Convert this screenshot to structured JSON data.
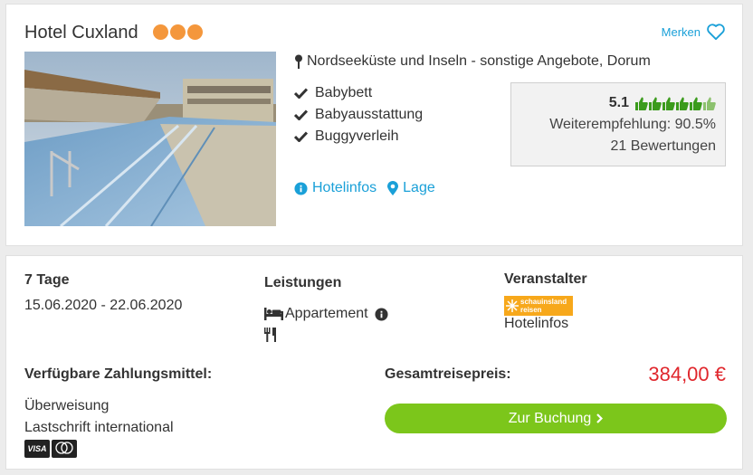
{
  "hotel": {
    "name": "Hotel Cuxland",
    "category_dots": 3,
    "merken_label": "Merken",
    "location": "Nordseeküste und Inseln - sonstige Angebote, Dorum",
    "features": [
      "Babybett",
      "Babyausstattung",
      "Buggyverleih"
    ],
    "links": {
      "hotelinfos": "Hotelinfos",
      "lage": "Lage"
    }
  },
  "rating": {
    "score": "5.1",
    "thumbs_total": 6,
    "thumbs_filled": 5,
    "recommendation": "Weiterempfehlung: 90.5%",
    "reviews": "21 Bewertungen"
  },
  "offer": {
    "duration": "7 Tage",
    "dates": "15.06.2020 - 22.06.2020",
    "services_title": "Leistungen",
    "room": "Appartement",
    "operator_title": "Veranstalter",
    "operator_logo_line1": "schauinsland",
    "operator_logo_line2": "reisen",
    "operator_link": "Hotelinfos",
    "payment_title": "Verfügbare Zahlungsmittel:",
    "payment_methods": [
      "Überweisung",
      "Lastschrift international"
    ],
    "card_visa": "VISA",
    "total_label": "Gesamtreisepreis:",
    "price": "384,00 €",
    "book_label": "Zur Buchung"
  },
  "colors": {
    "accent_blue": "#1aa0d8",
    "dots_orange": "#f4973c",
    "thumb_green": "#3b9b1c",
    "price_red": "#e0262c",
    "button_green": "#7cc61b"
  }
}
